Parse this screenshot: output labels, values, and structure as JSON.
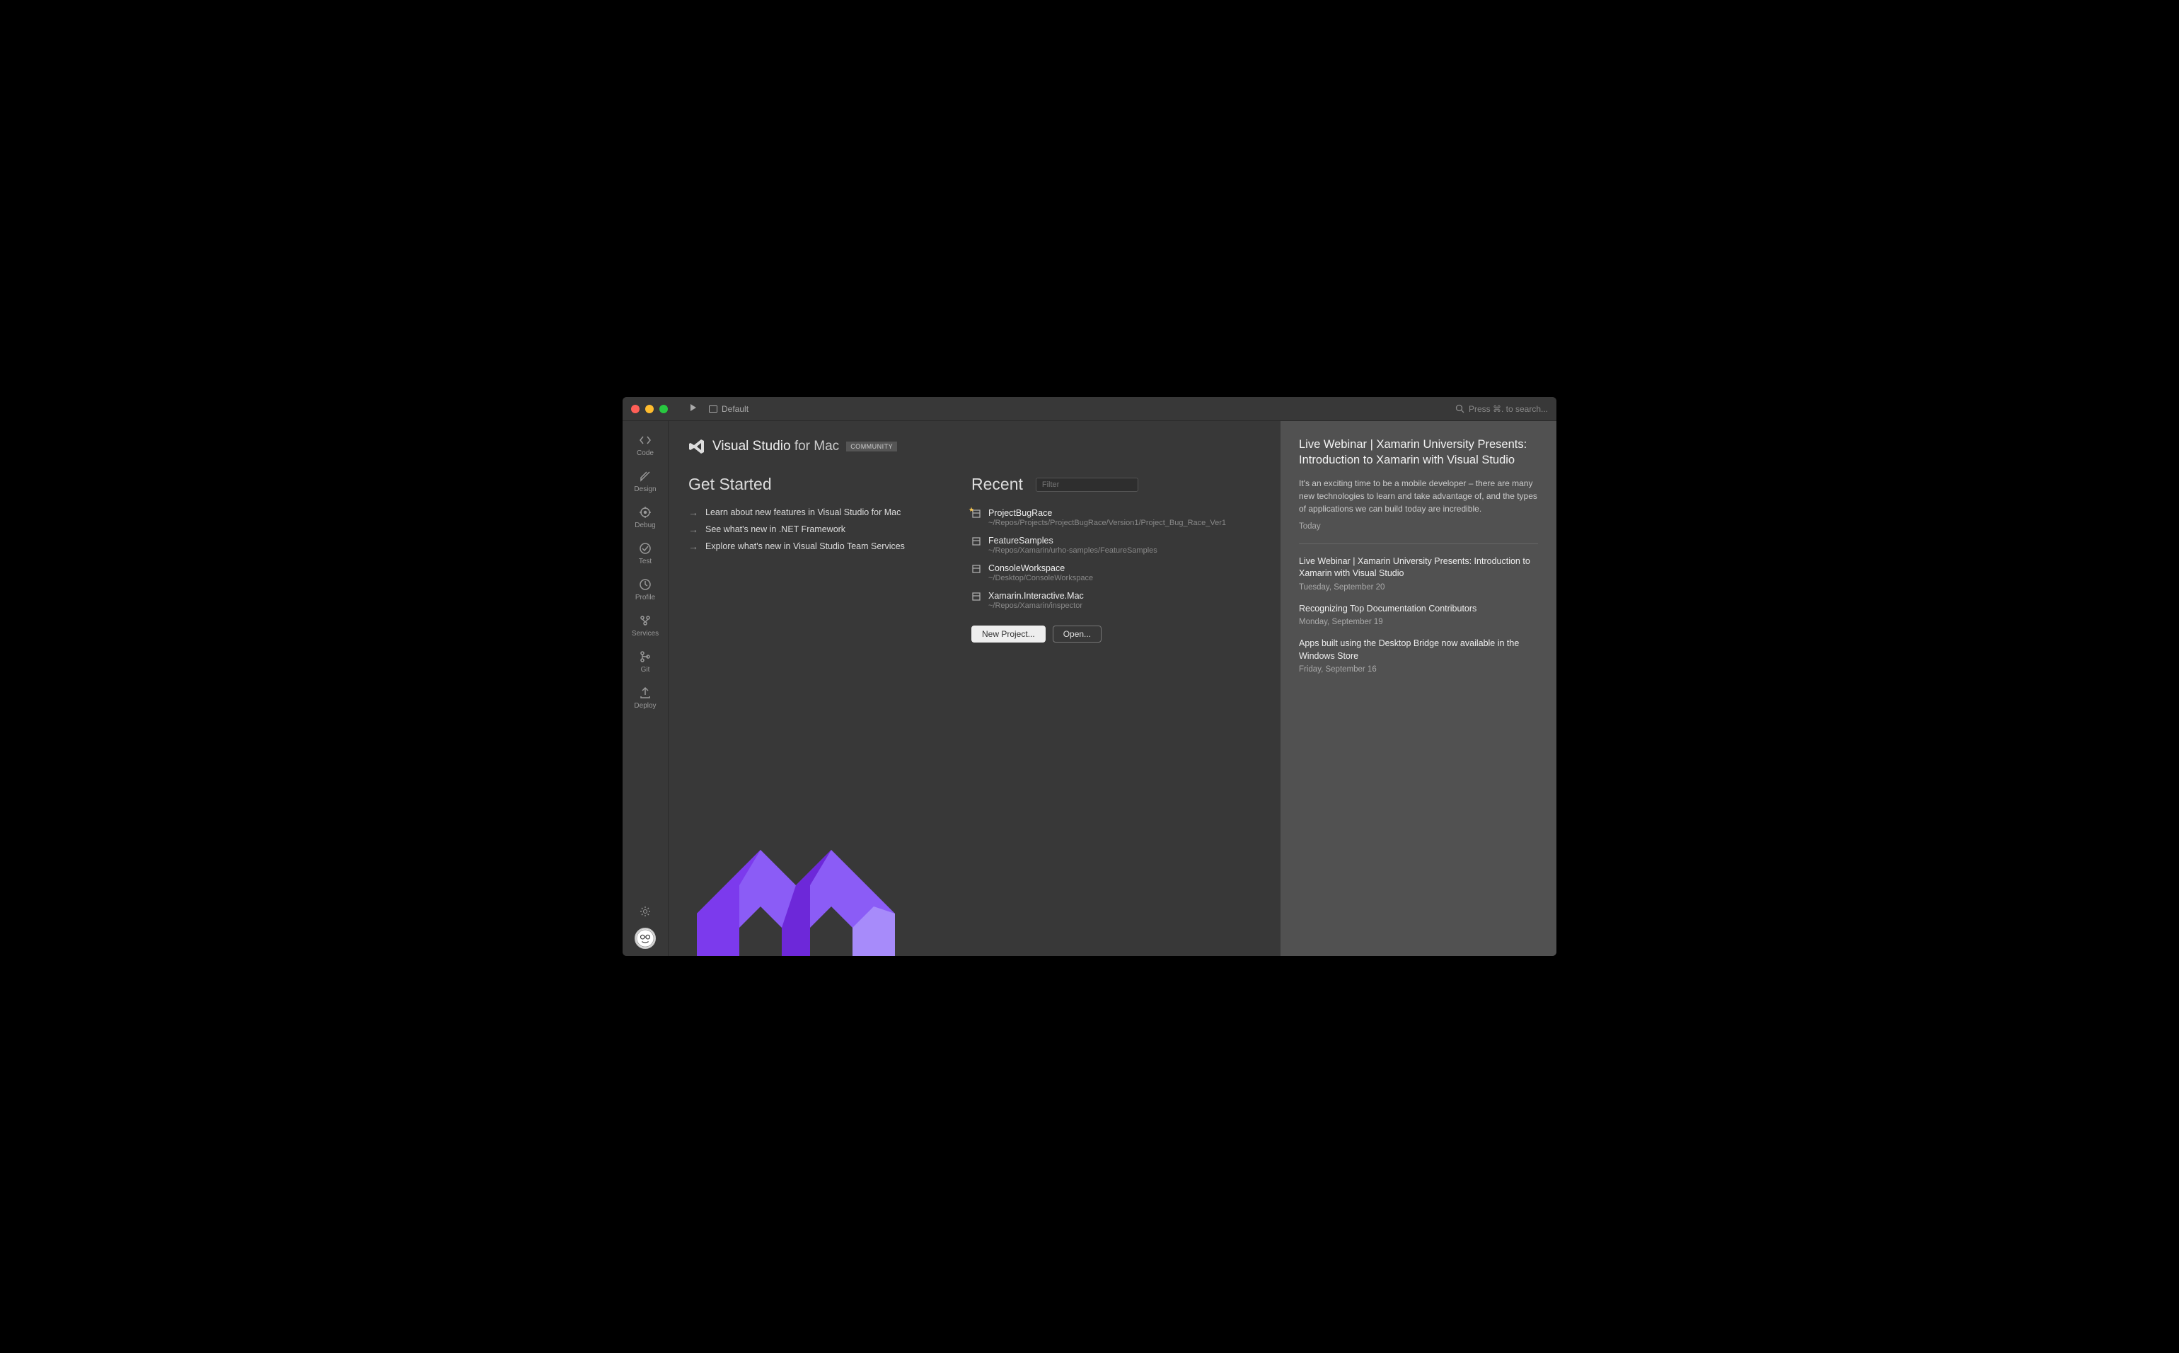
{
  "titlebar": {
    "default_label": "Default",
    "search_placeholder": "Press ⌘. to search..."
  },
  "sidebar": {
    "items": [
      {
        "label": "Code"
      },
      {
        "label": "Design"
      },
      {
        "label": "Debug"
      },
      {
        "label": "Test"
      },
      {
        "label": "Profile"
      },
      {
        "label": "Services"
      },
      {
        "label": "Git"
      },
      {
        "label": "Deploy"
      }
    ]
  },
  "logo": {
    "brand": "Visual Studio",
    "suffix": " for Mac",
    "edition": "COMMUNITY"
  },
  "get_started": {
    "title": "Get Started",
    "links": [
      "Learn about new features in Visual Studio for Mac",
      "See what's new in .NET Framework",
      "Explore what's new in Visual Studio Team Services"
    ]
  },
  "recent": {
    "title": "Recent",
    "filter_placeholder": "Filter",
    "items": [
      {
        "name": "ProjectBugRace",
        "path": "~/Repos/Projects/ProjectBugRace/Version1/Project_Bug_Race_Ver1",
        "starred": true
      },
      {
        "name": "FeatureSamples",
        "path": "~/Repos/Xamarin/urho-samples/FeatureSamples",
        "starred": false
      },
      {
        "name": "ConsoleWorkspace",
        "path": "~/Desktop/ConsoleWorkspace",
        "starred": false
      },
      {
        "name": "Xamarin.Interactive.Mac",
        "path": "~/Repos/Xamarin/inspector",
        "starred": false
      }
    ],
    "new_project_label": "New Project...",
    "open_label": "Open..."
  },
  "news": {
    "featured": {
      "title": "Live Webinar | Xamarin University Presents: Introduction to Xamarin with Visual Studio",
      "body": "It's an exciting time to be a mobile developer – there are many new technologies to learn and take advantage of, and the types of applications we can build today are incredible.",
      "date": "Today"
    },
    "items": [
      {
        "title": "Live Webinar | Xamarin University Presents: Introduction to Xamarin with Visual Studio",
        "date": "Tuesday, September 20"
      },
      {
        "title": "Recognizing Top Documentation Contributors",
        "date": "Monday, September 19"
      },
      {
        "title": "Apps built using the Desktop Bridge now available in the Windows Store",
        "date": "Friday, September 16"
      }
    ]
  }
}
